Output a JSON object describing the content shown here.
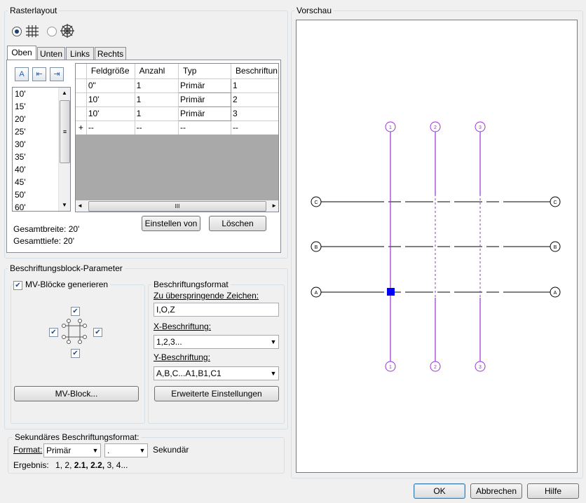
{
  "raster": {
    "title": "Rasterlayout",
    "tabs": [
      "Oben",
      "Unten",
      "Links",
      "Rechts"
    ],
    "sizes": [
      "10'",
      "15'",
      "20'",
      "25'",
      "30'",
      "35'",
      "40'",
      "45'",
      "50'",
      "60'"
    ],
    "table": {
      "headers": [
        "Feldgröße",
        "Anzahl",
        "Typ",
        "Beschriftun"
      ],
      "rows": [
        {
          "size": "0\"",
          "count": "1",
          "type": "Primär",
          "label": "1"
        },
        {
          "size": "10'",
          "count": "1",
          "type": "Primär",
          "label": "2"
        },
        {
          "size": "10'",
          "count": "1",
          "type": "Primär",
          "label": "3"
        }
      ],
      "new_row": {
        "marker": "+",
        "size": "--",
        "count": "--",
        "type": "--",
        "label": "--"
      },
      "scroll_mark": "III"
    },
    "buttons": {
      "set_from": "Einstellen von",
      "delete": "Löschen"
    },
    "total_width": "Gesamtbreite: 20'",
    "total_depth": "Gesamttiefe: 20'"
  },
  "label_block": {
    "title": "Beschriftungsblock-Parameter",
    "generate_label": "MV-Blöcke generieren",
    "mv_block_button": "MV-Block...",
    "format_title": "Beschriftungsformat",
    "skip_label": "Zu überspringende Zeichen:",
    "skip_value": "I,O,Z",
    "x_label": "X-Beschriftung:",
    "x_value": "1,2,3...",
    "y_label": "Y-Beschriftung:",
    "y_value": "A,B,C...A1,B1,C1",
    "advanced_button": "Erweiterte Einstellungen"
  },
  "secondary": {
    "title": "Sekundäres Beschriftungsformat:",
    "format_label": "Format:",
    "format_value": "Primär",
    "second_value": ".",
    "second_label": "Sekundär",
    "result_label": "Ergebnis:",
    "result_a": "1, 2, ",
    "result_b": "2.1, 2.2,",
    "result_c": " 3, 4..."
  },
  "preview": {
    "title": "Vorschau",
    "col_bubbles": [
      "1",
      "2",
      "3"
    ],
    "row_bubbles": [
      "C",
      "B",
      "A"
    ],
    "accent_color": "#9b30d9",
    "selected_color": "#0000ff"
  },
  "footer": {
    "ok": "OK",
    "cancel": "Abbrechen",
    "help": "Hilfe"
  }
}
